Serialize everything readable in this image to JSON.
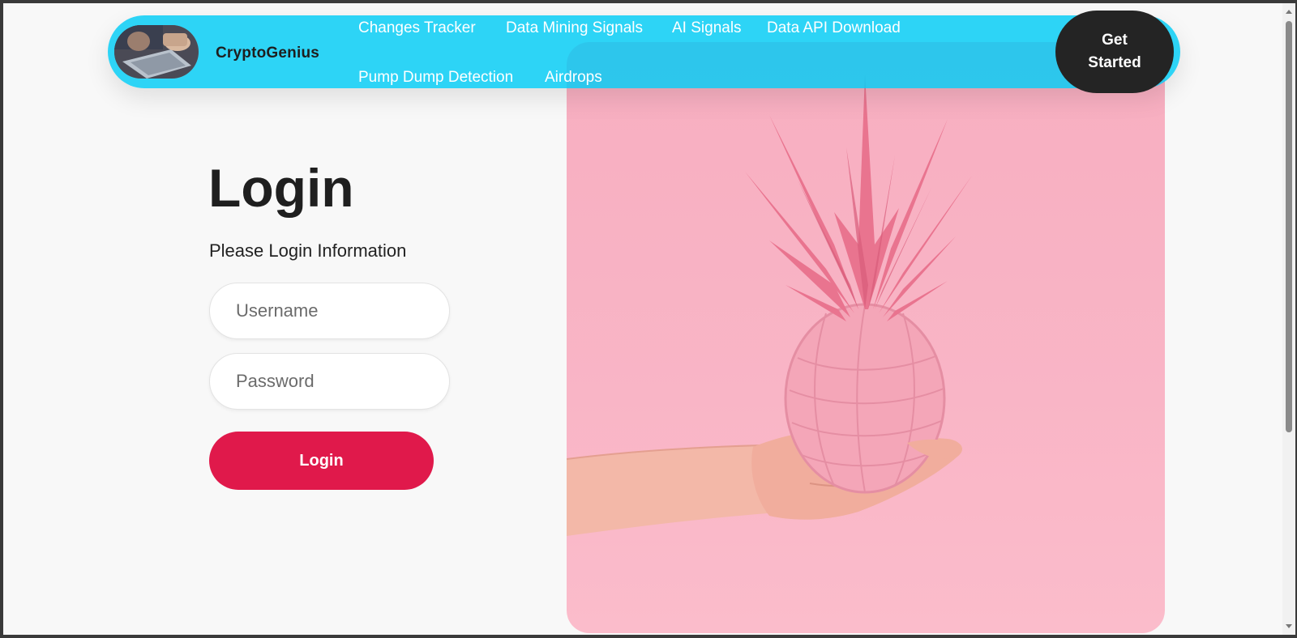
{
  "navbar": {
    "brand_name": "CryptoGenius",
    "links": [
      {
        "label": "Changes Tracker"
      },
      {
        "label": "Data Mining Signals"
      },
      {
        "label": "AI Signals"
      },
      {
        "label": "Data API Download"
      },
      {
        "label": "Pump Dump Detection"
      },
      {
        "label": "Airdrops"
      }
    ],
    "cta_label_line1": "Get",
    "cta_label_line2": "Started"
  },
  "login": {
    "title": "Login",
    "subtitle": "Please Login Information",
    "username_placeholder": "Username",
    "password_placeholder": "Password",
    "submit_label": "Login"
  },
  "colors": {
    "navbar_bg": "#00ccf5",
    "cta_bg": "#242424",
    "login_button_bg": "#e0194b",
    "hero_bg": "#f9b5c6"
  },
  "icons": {
    "brand_logo": "laptop-photo-avatar",
    "hero_image": "pink-pineapple-in-hand"
  }
}
